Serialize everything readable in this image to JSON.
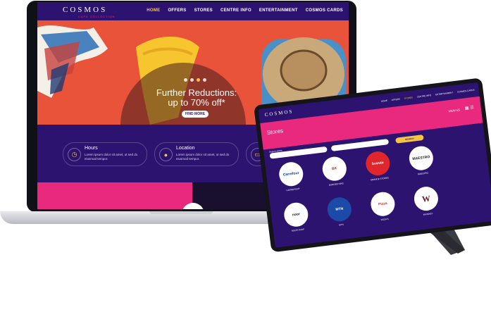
{
  "laptop": {
    "logo": "COSMOS",
    "logo_sub": "CAPE COLLECTION",
    "nav": [
      "HOME",
      "OFFERS",
      "STORES",
      "CENTRE INFO",
      "ENTERTAINMENT",
      "COSMOS CARDS"
    ],
    "active_nav": 0,
    "hero_line1": "Further Reductions:",
    "hero_line2": "up to 70% off*",
    "hero_button": "FIND MORE",
    "slides_active": 2,
    "hours_title": "Hours",
    "hours_text": "Lorem ipsum dolor sit amet, ut sed do eiusmod tempor.",
    "location_title": "Location",
    "location_text": "Lorem ipsum dolor sit amet, ut sed do eiusmod tempor."
  },
  "tablet": {
    "logo": "COSMOS",
    "nav": [
      "HOME",
      "OFFERS",
      "STORES",
      "CENTRE INFO",
      "ENTERTAINMENT",
      "COSMOS CARDS"
    ],
    "active_nav": 2,
    "page_title": "Stores",
    "view_as": "VIEW AS",
    "search_label": "Search stores",
    "search_button": "SEARCH",
    "stores": [
      {
        "name": "CARREFOUR",
        "logo": "Carrefour",
        "color": "#0a3d91"
      },
      {
        "name": "BURGER KING",
        "logo": "BK",
        "color": "#d62300"
      },
      {
        "name": "BRANDE STORES",
        "logo": "brande",
        "color": "#e1252c"
      },
      {
        "name": "MAESTRO",
        "logo": "MAESTRO",
        "color": "#1a1a1a"
      },
      {
        "name": "NOOR SHOP",
        "logo": "noor",
        "color": "#1a1a1a"
      },
      {
        "name": "MTN",
        "logo": "MTN",
        "color": "#1b4aa8"
      },
      {
        "name": "PIZZA'S",
        "logo": "Pizza",
        "color": "#e1252c"
      },
      {
        "name": "WHISKEY",
        "logo": "W",
        "color": "#6b1d2a"
      }
    ]
  },
  "colors": {
    "purple": "#2c1370",
    "pink": "#e8297e",
    "coral": "#e8533a",
    "gold": "#f6c445"
  }
}
